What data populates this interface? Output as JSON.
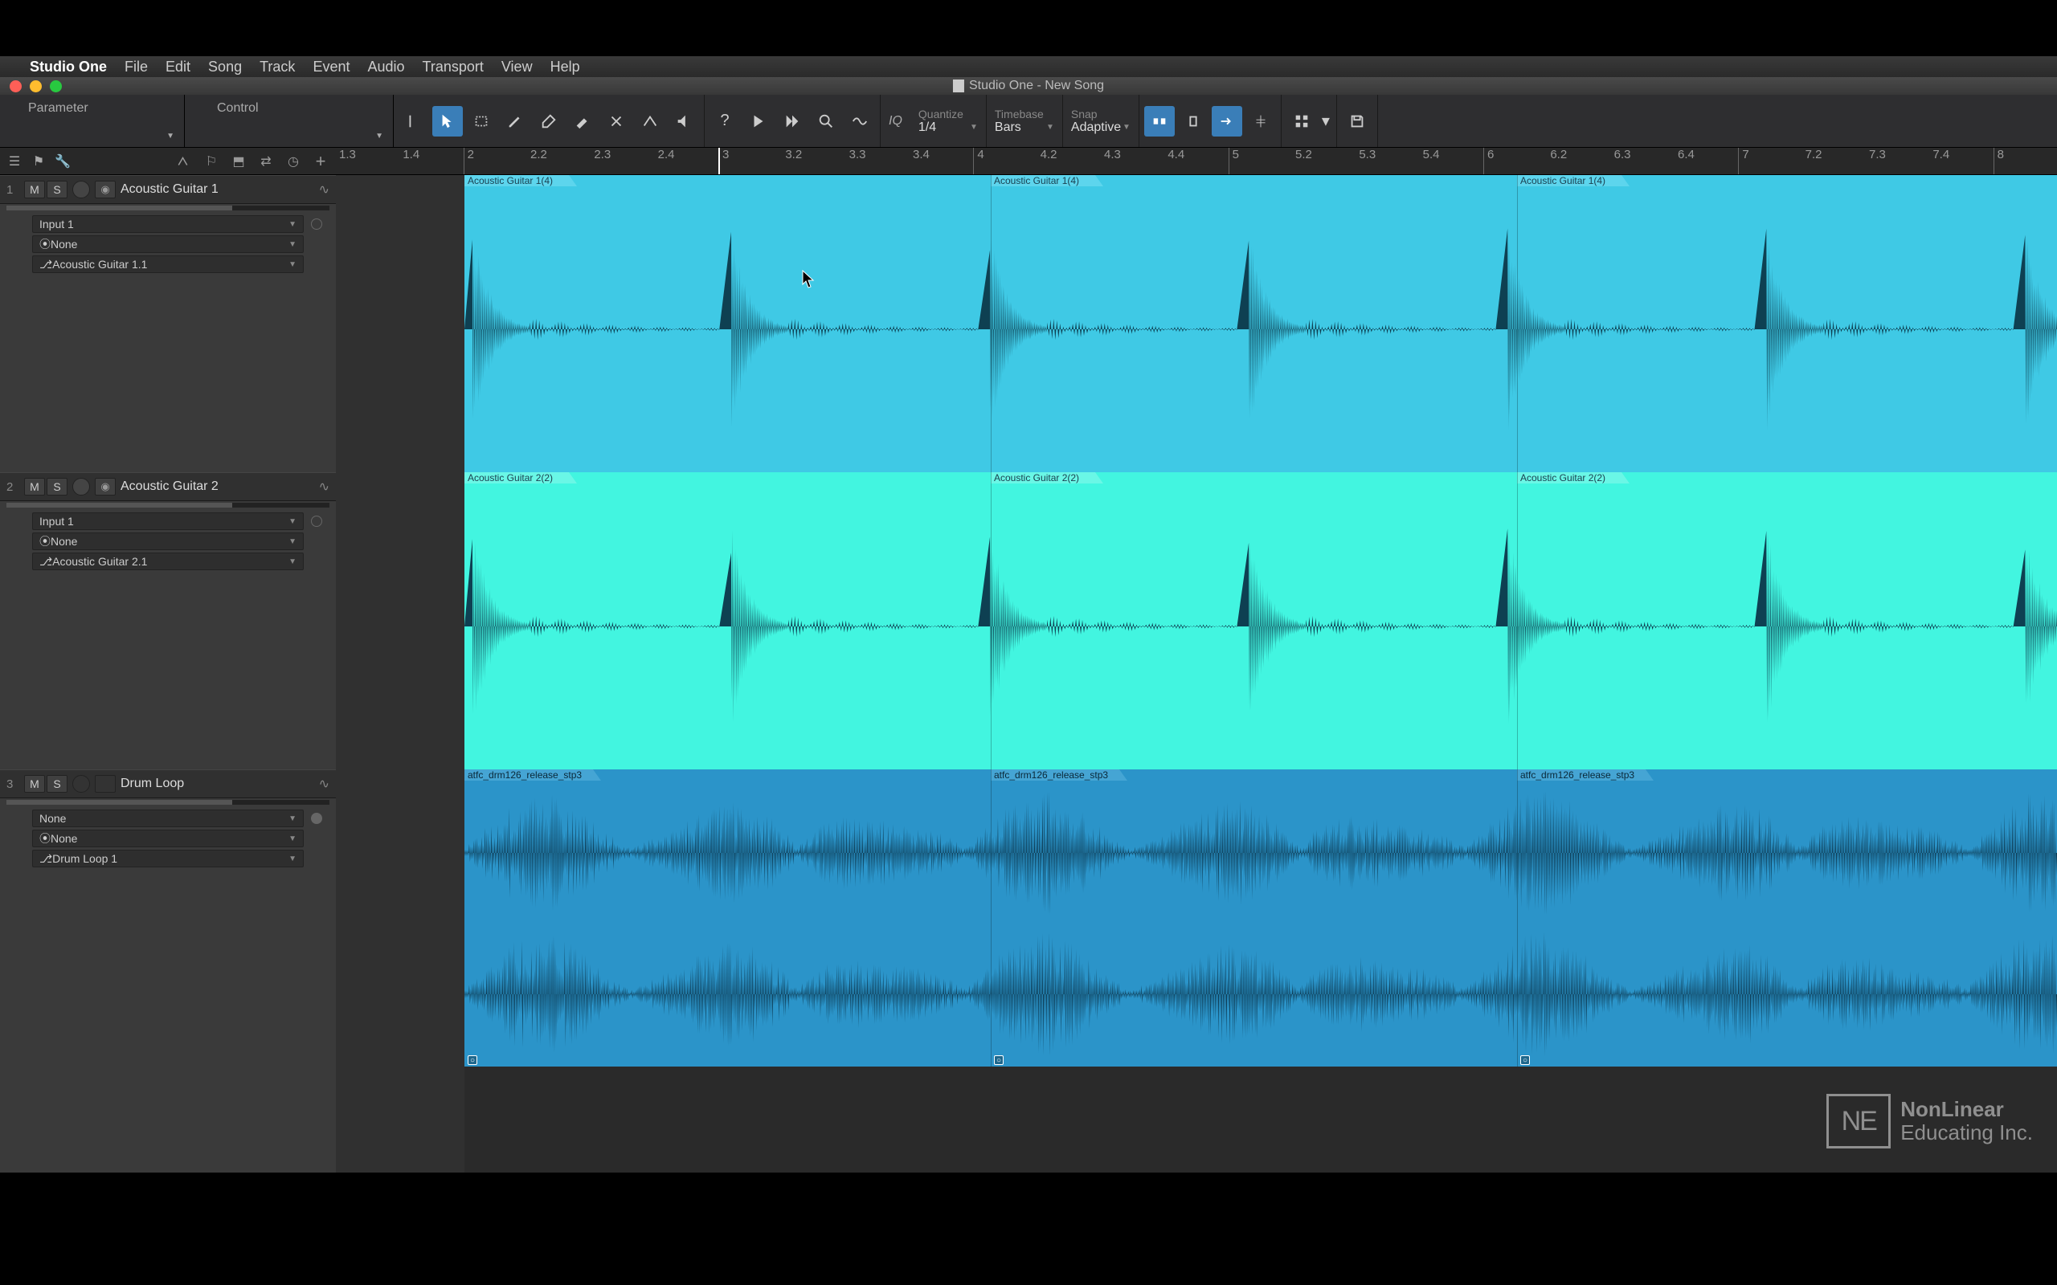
{
  "menubar": {
    "app": "Studio One",
    "items": [
      "File",
      "Edit",
      "Song",
      "Track",
      "Event",
      "Audio",
      "Transport",
      "View",
      "Help"
    ]
  },
  "window": {
    "title": "Studio One - New Song"
  },
  "toolbar": {
    "parameter_label": "Parameter",
    "control_label": "Control",
    "quantize": {
      "label": "Quantize",
      "value": "1/4"
    },
    "timebase": {
      "label": "Timebase",
      "value": "Bars"
    },
    "snap": {
      "label": "Snap",
      "value": "Adaptive"
    },
    "iq": "IQ"
  },
  "ruler": {
    "ticks": [
      "1.3",
      "1.4",
      "2",
      "2.2",
      "2.3",
      "2.4",
      "3",
      "3.2",
      "3.3",
      "3.4",
      "4",
      "4.2",
      "4.3",
      "4.4",
      "5",
      "5.2",
      "5.3",
      "5.4",
      "6",
      "6.2",
      "6.3",
      "6.4",
      "7",
      "7.2",
      "7.3",
      "7.4",
      "8"
    ]
  },
  "tracks": [
    {
      "num": "1",
      "name": "Acoustic Guitar 1",
      "input": "Input 1",
      "output": "None",
      "channel": "Acoustic Guitar 1.1",
      "clips": [
        "Acoustic Guitar 1(4)",
        "Acoustic Guitar 1(4)",
        "Acoustic Guitar 1(4)"
      ]
    },
    {
      "num": "2",
      "name": "Acoustic Guitar 2",
      "input": "Input 1",
      "output": "None",
      "channel": "Acoustic Guitar 2.1",
      "clips": [
        "Acoustic Guitar 2(2)",
        "Acoustic Guitar 2(2)",
        "Acoustic Guitar 2(2)"
      ]
    },
    {
      "num": "3",
      "name": "Drum Loop",
      "input": "None",
      "output": "None",
      "channel": "Drum Loop 1",
      "clips": [
        "atfc_drm126_release_stp3",
        "atfc_drm126_release_stp3",
        "atfc_drm126_release_stp3"
      ]
    }
  ],
  "mute_label": "M",
  "solo_label": "S",
  "watermark": {
    "box": "NE",
    "line1": "NonLinear",
    "line2": "Educating Inc."
  }
}
